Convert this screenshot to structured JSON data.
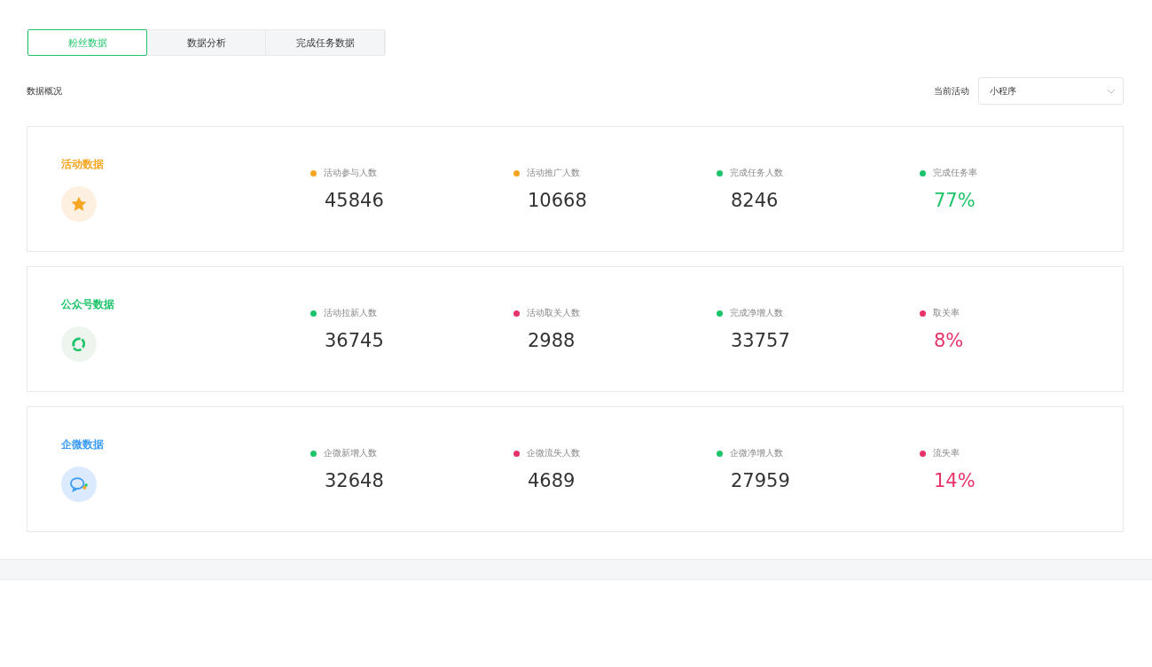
{
  "tabs": [
    {
      "label": "粉丝数据",
      "selected": true
    },
    {
      "label": "数据分析",
      "selected": false
    },
    {
      "label": "完成任务数据",
      "selected": false
    }
  ],
  "overview": {
    "title": "数据概况",
    "filter_label": "当前活动",
    "filter_value": "小程序"
  },
  "cards": [
    {
      "title": "活动数据",
      "kind": "star",
      "color": "#f5a623",
      "metrics": [
        {
          "label": "活动参与人数",
          "value": "45846",
          "color": "#f5a623",
          "kind": "count"
        },
        {
          "label": "活动推广人数",
          "value": "10668",
          "color": "#f5a623",
          "kind": "count"
        },
        {
          "label": "完成任务人数",
          "value": "8246",
          "color": "#1ec46a",
          "kind": "count"
        },
        {
          "label": "完成任务率",
          "value": "77%",
          "color": "#1ec46a",
          "kind": "rate"
        }
      ]
    },
    {
      "title": "公众号数据",
      "kind": "wechat",
      "color": "#1ec46a",
      "metrics": [
        {
          "label": "活动拉新人数",
          "value": "36745",
          "color": "#1ec46a",
          "kind": "count"
        },
        {
          "label": "活动取关人数",
          "value": "2988",
          "color": "#e8336a",
          "kind": "count"
        },
        {
          "label": "完成净增人数",
          "value": "33757",
          "color": "#1ec46a",
          "kind": "count"
        },
        {
          "label": "取关率",
          "value": "8%",
          "color": "#e8336a",
          "kind": "rate"
        }
      ]
    },
    {
      "title": "企微数据",
      "kind": "wecom",
      "color": "#3b9cf5",
      "metrics": [
        {
          "label": "企微新增人数",
          "value": "32648",
          "color": "#1ec46a",
          "kind": "count"
        },
        {
          "label": "企微流失人数",
          "value": "4689",
          "color": "#e8336a",
          "kind": "count"
        },
        {
          "label": "企微净增人数",
          "value": "27959",
          "color": "#1ec46a",
          "kind": "count"
        },
        {
          "label": "流失率",
          "value": "14%",
          "color": "#e8336a",
          "kind": "rate"
        }
      ]
    }
  ]
}
